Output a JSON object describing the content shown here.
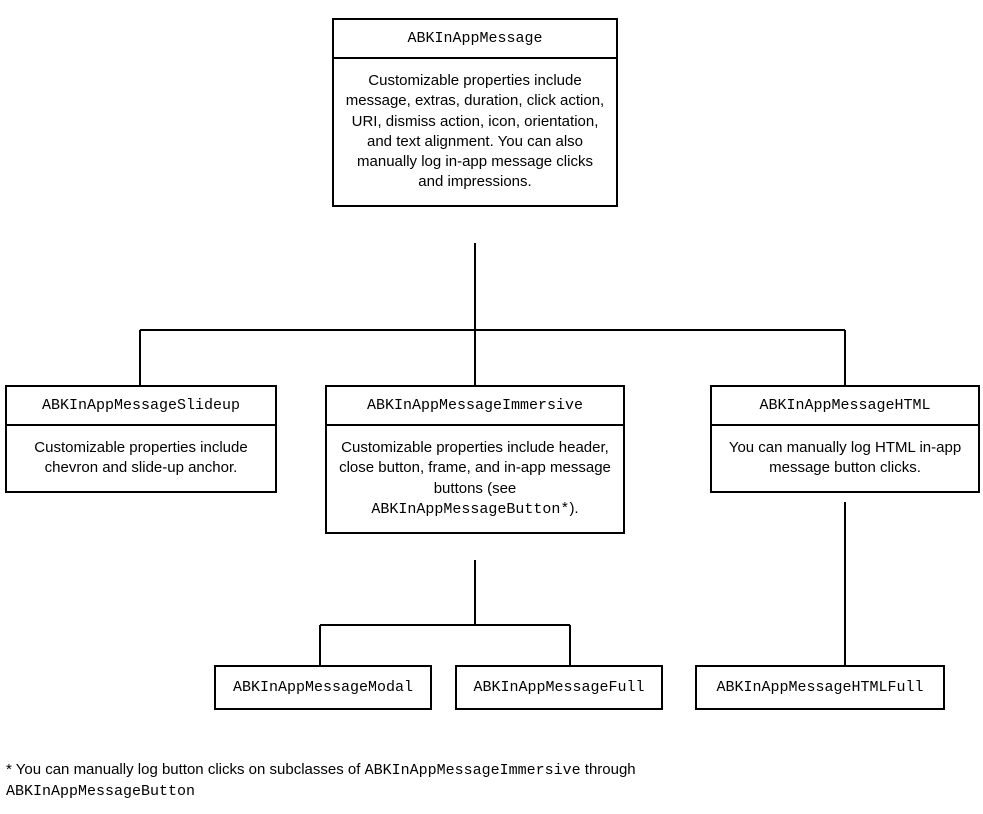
{
  "root": {
    "title": "ABKInAppMessage",
    "body": "Customizable properties include message, extras, duration, click action, URI, dismiss action, icon, orientation, and text alignment. You can also manually log in-app message clicks and impressions."
  },
  "slideup": {
    "title": "ABKInAppMessageSlideup",
    "body": "Customizable properties include chevron and slide-up anchor."
  },
  "immersive": {
    "title": "ABKInAppMessageImmersive",
    "body_pre": "Customizable properties include header, close button, frame, and in-app message buttons (see ",
    "body_code": "ABKInAppMessageButton*",
    "body_post": ")."
  },
  "html": {
    "title": "ABKInAppMessageHTML",
    "body": "You can manually log HTML in-app message button clicks."
  },
  "modal": {
    "title": "ABKInAppMessageModal"
  },
  "full": {
    "title": "ABKInAppMessageFull"
  },
  "htmlfull": {
    "title": "ABKInAppMessageHTMLFull"
  },
  "footnote": {
    "pre": "* You can manually log button clicks on subclasses of ",
    "code1": "ABKInAppMessageImmersive",
    "mid": " through ",
    "code2": "ABKInAppMessageButton"
  }
}
